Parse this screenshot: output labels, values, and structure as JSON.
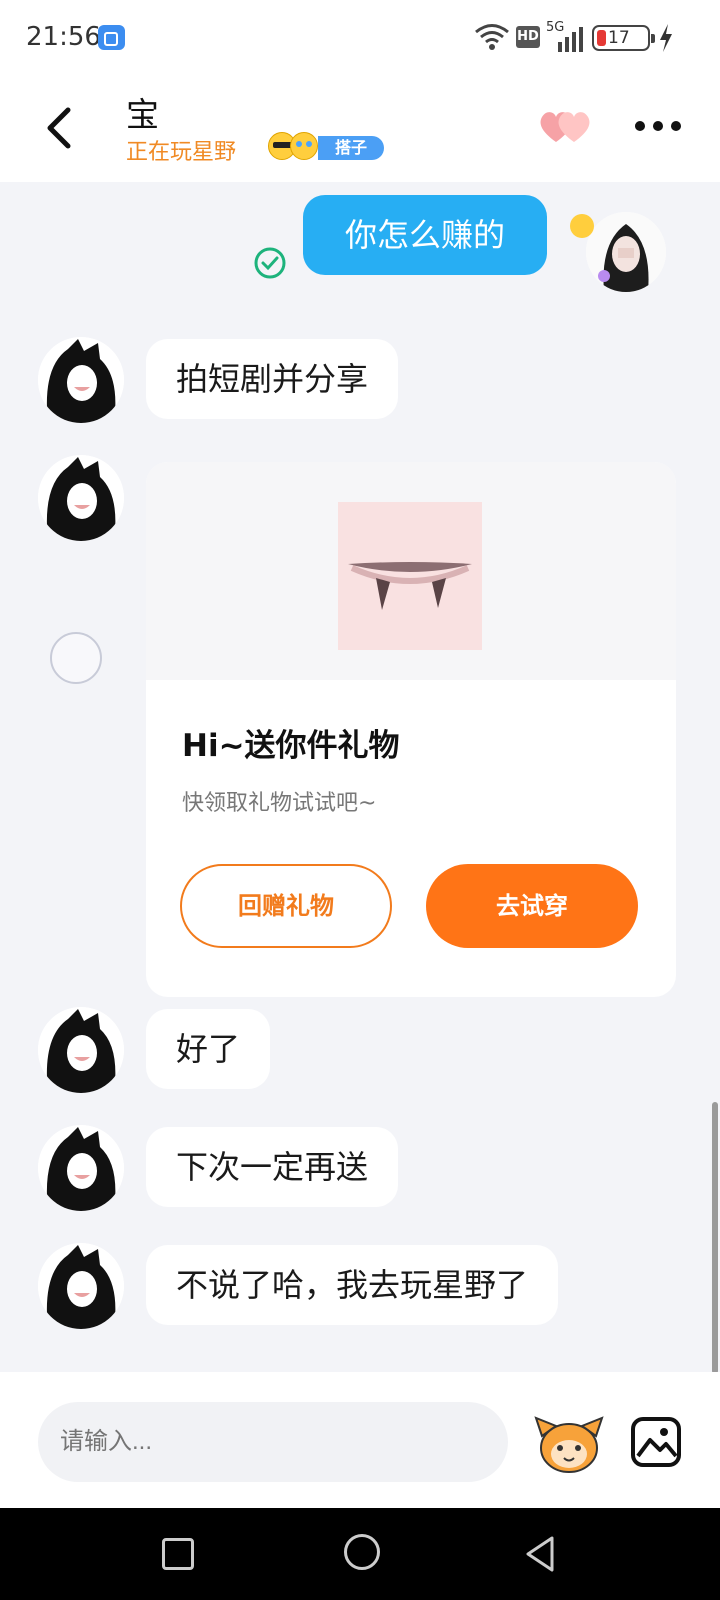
{
  "status_bar": {
    "time": "21:56",
    "network": "5G",
    "hd": "HD",
    "battery": "17",
    "battery_color": "#e53935"
  },
  "header": {
    "contact_name": "宝",
    "status": "正在玩星野",
    "badge": "搭子",
    "status_color": "#f08a24",
    "badge_color": "#4b9ff5",
    "back_icon": "chevron-left-icon",
    "hearts_icon": "hearts-icon",
    "more_icon": "more-dots-icon"
  },
  "messages": [
    {
      "direction": "out",
      "text": "你怎么赚的",
      "color": "#27aef3"
    },
    {
      "direction": "in",
      "text": "拍短剧并分享"
    },
    {
      "direction": "in",
      "type": "gift-card"
    },
    {
      "direction": "in",
      "text": "好了"
    },
    {
      "direction": "in",
      "text": "下次一定再送"
    },
    {
      "direction": "in",
      "text": "不说了哈，我去玩星野了"
    }
  ],
  "gift_card": {
    "title": "Hi~送你件礼物",
    "subtitle": "快领取礼物试试吧~",
    "return_button": "回赠礼物",
    "try_button": "去试穿",
    "accent_color": "#ff7416"
  },
  "input": {
    "placeholder": "请输入..."
  }
}
